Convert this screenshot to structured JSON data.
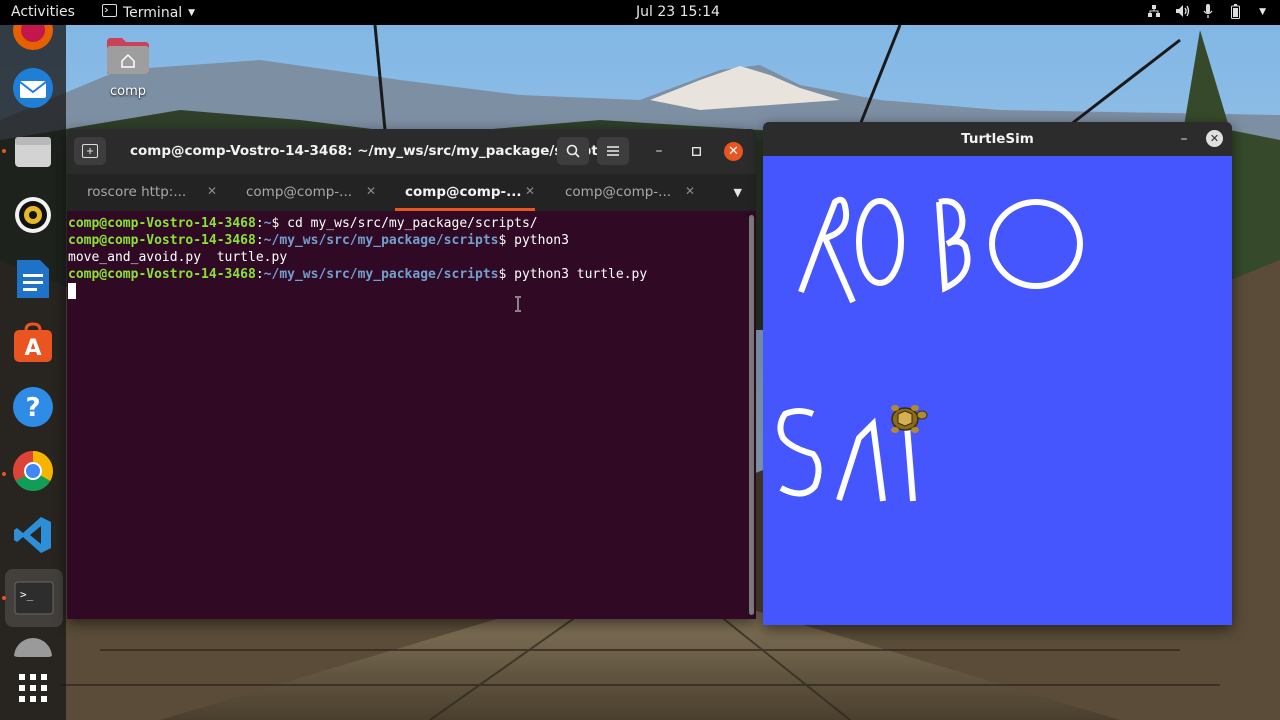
{
  "topbar": {
    "activities": "Activities",
    "app_menu": "Terminal",
    "clock": "Jul 23  15:14",
    "tray_icons": [
      "network-icon",
      "volume-icon",
      "microphone-icon",
      "battery-icon"
    ]
  },
  "desktop": {
    "home_folder_label": "comp"
  },
  "dock": {
    "items": [
      "firefox-icon",
      "thunderbird-icon",
      "files-icon",
      "rhythmbox-icon",
      "writer-icon",
      "software-icon",
      "help-icon",
      "chrome-icon",
      "vscode-icon",
      "terminal-icon",
      "ubuntu-icon",
      "show-apps-icon"
    ]
  },
  "terminal": {
    "title": "comp@comp-Vostro-14-3468: ~/my_ws/src/my_package/scripts",
    "tabs": [
      {
        "label": "roscore http:...",
        "active": false
      },
      {
        "label": "comp@comp-...",
        "active": false
      },
      {
        "label": "comp@comp-...",
        "active": true
      },
      {
        "label": "comp@comp-...",
        "active": false
      }
    ],
    "lines": [
      {
        "user": "comp@comp-Vostro-14-3468",
        "sep": ":",
        "path": "~",
        "cmd": "$ cd my_ws/src/my_package/scripts/"
      },
      {
        "user": "comp@comp-Vostro-14-3468",
        "sep": ":",
        "path": "~/my_ws/src/my_package/scripts",
        "cmd": "$ python3"
      },
      {
        "output": "move_and_avoid.py  turtle.py"
      },
      {
        "user": "comp@comp-Vostro-14-3468",
        "sep": ":",
        "path": "~/my_ws/src/my_package/scripts",
        "cmd": "$ python3 turtle.py"
      }
    ]
  },
  "turtlesim": {
    "title": "TurtleSim",
    "background_color": "#4556ff",
    "pen_color": "#ffffff"
  }
}
